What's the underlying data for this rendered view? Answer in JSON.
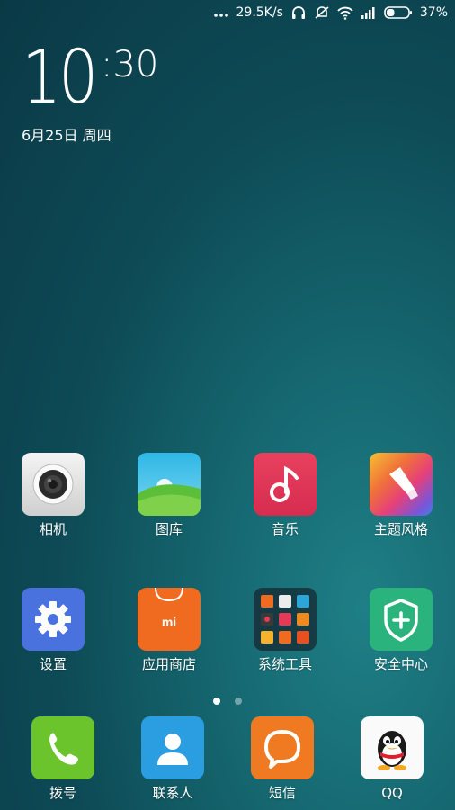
{
  "status_bar": {
    "network_speed": "29.5K/s",
    "battery_percent": "37%",
    "battery_level": 0.37,
    "icons": [
      "more-dots-icon",
      "headphone-icon",
      "mute-vibrate-icon",
      "wifi-icon",
      "signal-icon",
      "battery-icon"
    ]
  },
  "clock": {
    "hour": "10",
    "minute": ":30"
  },
  "date": "6月25日 周四",
  "apps_row1": [
    {
      "label": "相机",
      "icon": "camera-icon"
    },
    {
      "label": "图库",
      "icon": "gallery-icon"
    },
    {
      "label": "音乐",
      "icon": "music-icon"
    },
    {
      "label": "主题风格",
      "icon": "theme-icon"
    }
  ],
  "apps_row2": [
    {
      "label": "设置",
      "icon": "settings-gear-icon"
    },
    {
      "label": "应用商店",
      "icon": "app-store-icon",
      "icon_text": "mi"
    },
    {
      "label": "系统工具",
      "icon": "system-tools-folder-icon"
    },
    {
      "label": "安全中心",
      "icon": "security-shield-icon"
    }
  ],
  "page_indicator": {
    "count": 2,
    "active": 0
  },
  "dock": [
    {
      "label": "拨号",
      "icon": "phone-icon"
    },
    {
      "label": "联系人",
      "icon": "contacts-icon"
    },
    {
      "label": "短信",
      "icon": "messages-icon"
    },
    {
      "label": "QQ",
      "icon": "qq-penguin-icon"
    }
  ],
  "colors": {
    "camera": "#e8e8e8",
    "gallery_sky": "#35c6e8",
    "gallery_grass": "#5cbf3a",
    "music": "#e33a57",
    "settings": "#4a72de",
    "app_store": "#f06b1f",
    "security": "#2bb37d",
    "phone": "#6cc42c",
    "contacts": "#2a9ee0",
    "messages": "#f07a22"
  }
}
